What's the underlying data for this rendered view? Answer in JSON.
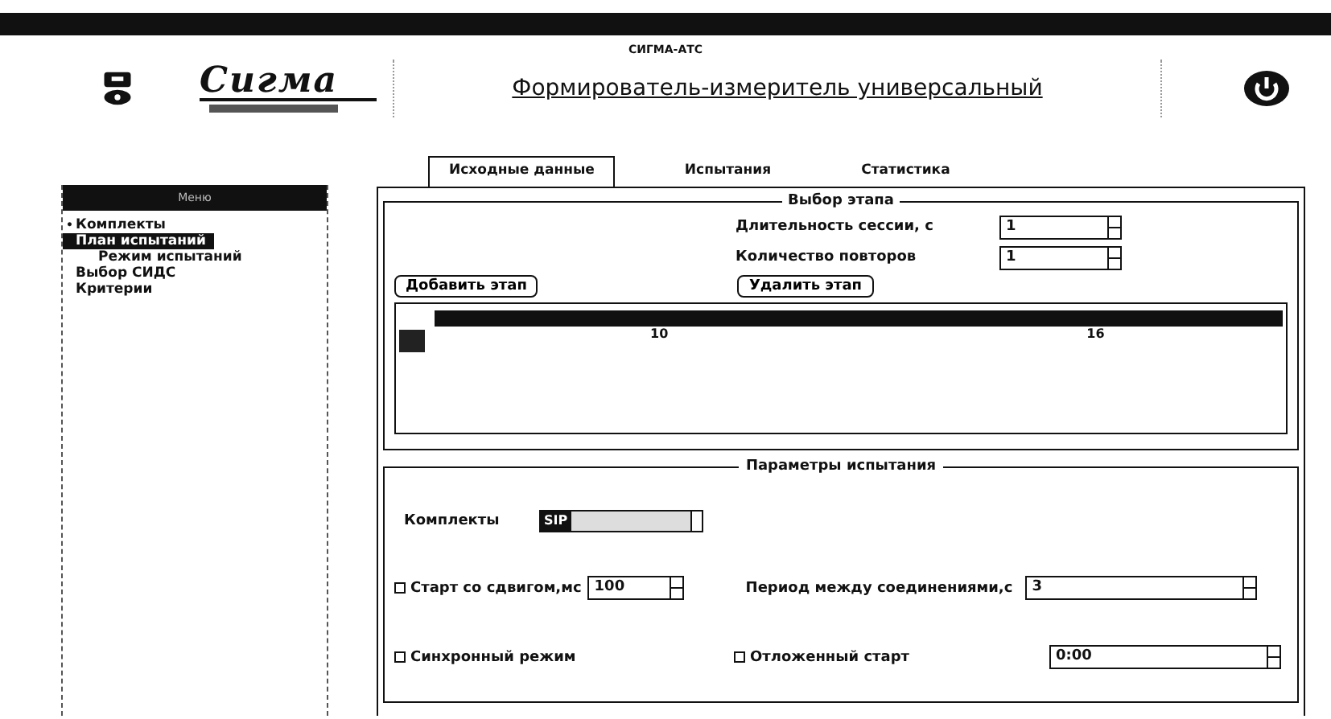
{
  "window": {
    "title": "СИГМА-АТС"
  },
  "header": {
    "logo": "Сигма",
    "heading": "Формирователь-измеритель универсальный"
  },
  "sidebar": {
    "title": "Меню",
    "items": [
      {
        "label": "Комплекты",
        "selected": false,
        "marker": "•"
      },
      {
        "label": "План испытаний",
        "selected": true,
        "children": [
          {
            "label": "Режим испытаний",
            "selected": false
          }
        ]
      },
      {
        "label": "Выбор СИДС",
        "selected": false
      },
      {
        "label": "Критерии",
        "selected": false
      }
    ]
  },
  "tabs": [
    {
      "label": "Исходные данные",
      "selected": true
    },
    {
      "label": "Испытания",
      "selected": false
    },
    {
      "label": "Статистика",
      "selected": false
    }
  ],
  "stage_section": {
    "title": "Выбор этапа",
    "fields": [
      {
        "label": "Длительность сессии, с",
        "value": "1"
      },
      {
        "label": "Количество повторов",
        "value": "1"
      }
    ],
    "buttons": [
      "Добавить этап",
      "Удалить этап"
    ],
    "timeline": {
      "ticks": [
        "10",
        "16"
      ]
    }
  },
  "params_section": {
    "title": "Параметры испытания",
    "kits": {
      "label": "Комплекты",
      "value": "SIP"
    },
    "shift": {
      "label": "Старт со сдвигом,мс",
      "checked": false,
      "value": "100"
    },
    "period": {
      "label": "Период между соединениями,с",
      "value": "3"
    },
    "sync": {
      "label": "Синхронный режим",
      "checked": false
    },
    "delayed": {
      "label": "Отложенный старт",
      "checked": false,
      "value": "0:00"
    }
  }
}
